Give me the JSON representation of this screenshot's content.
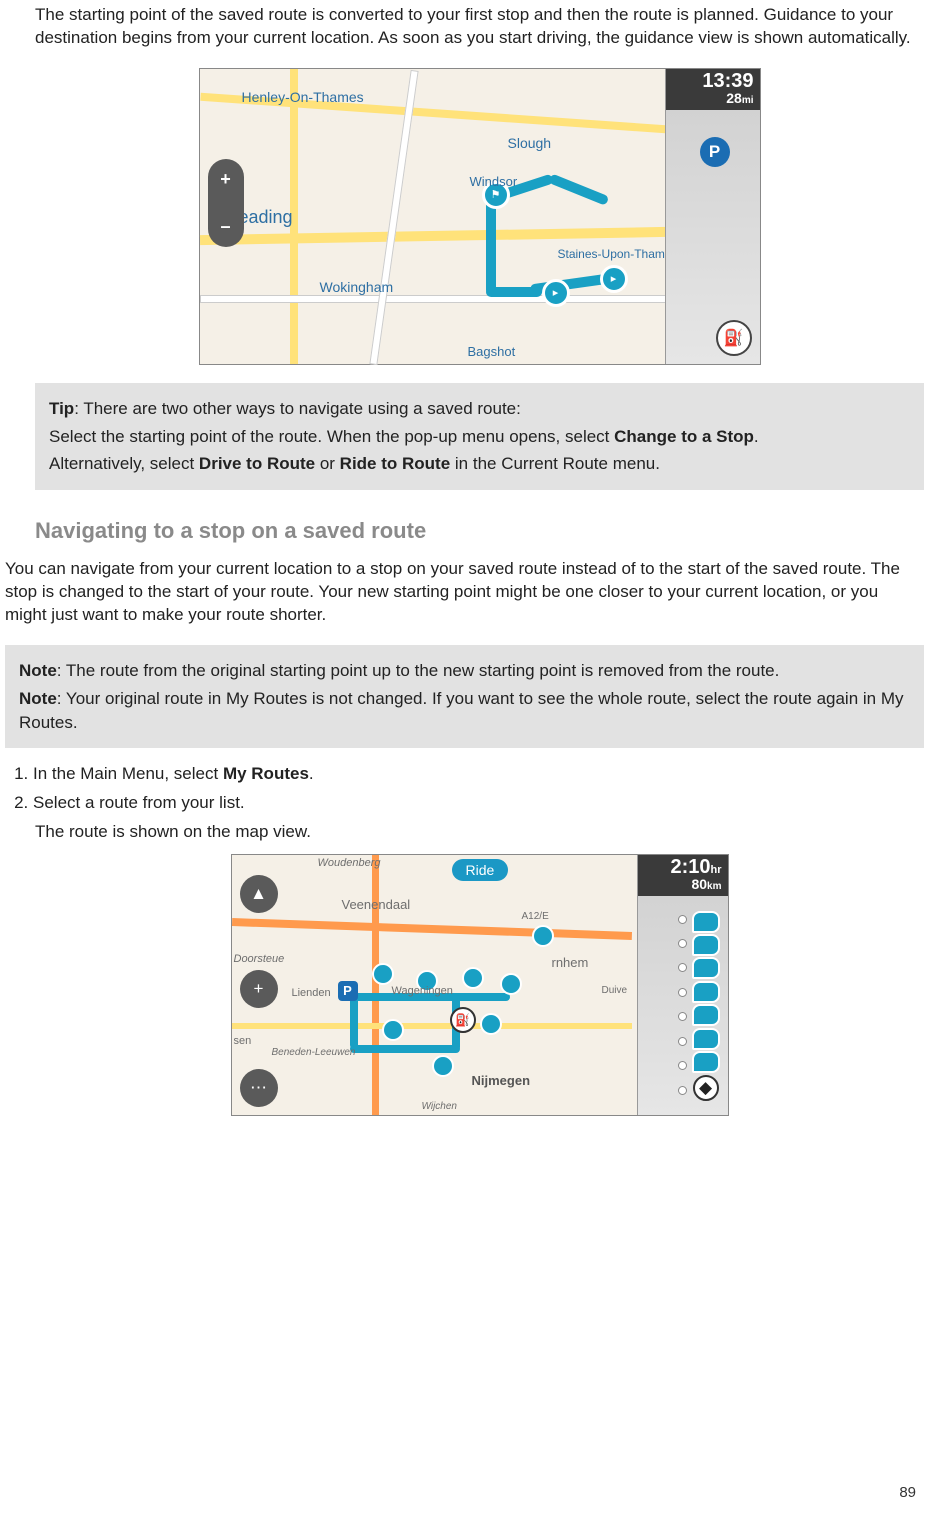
{
  "intro_para": "The starting point of the saved route is converted to your first stop and then the route is planned. Guidance to your destination begins from your current location. As soon as you start driving, the guidance view is shown automatically.",
  "map1": {
    "sidebar_time": "13:39",
    "sidebar_dist_value": "28",
    "sidebar_dist_unit": "mi",
    "labels": {
      "henley": "Henley-On-Thames",
      "slough": "Slough",
      "windsor": "Windsor",
      "reading": "Reading",
      "wokingham": "Wokingham",
      "staines": "Staines-Upon-Thames",
      "bagshot": "Bagshot"
    },
    "zoom_plus": "+",
    "zoom_minus": "–"
  },
  "tip_box": {
    "label": "Tip",
    "line1": ": There are two other ways to navigate using a saved route:",
    "line2a": "Select the starting point of the route. When the pop-up menu opens, select ",
    "line2b_bold": "Change to a Stop",
    "line2c": ".",
    "line3a": "Alternatively, select ",
    "line3b_bold": "Drive to Route",
    "line3c": " or ",
    "line3d_bold": "Ride to Route",
    "line3e": " in the Current Route menu."
  },
  "section_heading": "Navigating to a stop on a saved route",
  "section_para": "You can navigate from your current location to a stop on your saved route instead of to the start of the saved route. The stop is changed to the start of your route. Your new starting point might be one closer to your current location, or you might just want to make your route shorter.",
  "note_box": {
    "label": "Note",
    "n1": ": The route from the original starting point up to the new starting point is removed from the route.",
    "n2": ": Your original route in My Routes is not changed. If you want to see the whole route, select the route again in My Routes."
  },
  "steps": {
    "s1a": "In the Main Menu, select ",
    "s1b_bold": "My Routes",
    "s1c": ".",
    "s2": "Select a route from your list.",
    "s2_sub": "The route is shown on the map view."
  },
  "map2": {
    "ride_label": "Ride",
    "sidebar_time_value": "2:10",
    "sidebar_time_unit": "hr",
    "sidebar_dist_value": "80",
    "sidebar_dist_unit": "km",
    "labels": {
      "woudenberg": "Woudenberg",
      "veenendaal": "Veenendaal",
      "lienden": "Lienden",
      "wageningen": "Wageningen",
      "rnhem": "rnhem",
      "duive": "Duive",
      "sen": "sen",
      "beneden": "Beneden-Leeuwen",
      "nijmegen": "Nijmegen",
      "wijchen": "Wijchen",
      "doorsteue": "Doorsteue",
      "a12": "A12/E"
    },
    "parking_p": "P"
  },
  "page_number": "89"
}
